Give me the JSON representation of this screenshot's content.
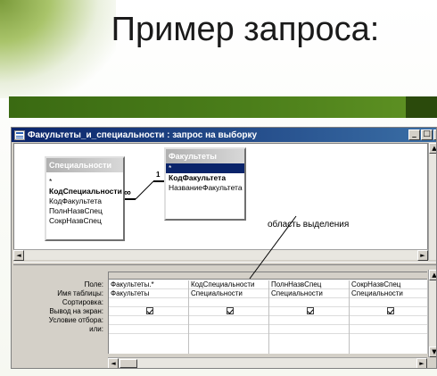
{
  "slide": {
    "title": "Пример запроса:"
  },
  "window": {
    "title": "Факультеты_и_специальности : запрос на выборку",
    "controls": [
      "_",
      "□",
      "×"
    ]
  },
  "tables": {
    "left": {
      "name": "Специальности",
      "fields": [
        "*",
        "КодСпециальности",
        "КодФакультета",
        "ПолнНазвСпец",
        "СокрНазвСпец"
      ]
    },
    "right": {
      "name": "Факультеты",
      "fields": [
        "*",
        "КодФакультета",
        "НазваниеФакультета"
      ]
    }
  },
  "relation": {
    "many": "∞",
    "one": "1"
  },
  "annotation": "область выделения",
  "grid": {
    "row_labels": [
      "Поле:",
      "Имя таблицы:",
      "Сортировка:",
      "Вывод на экран:",
      "Условие отбора:",
      "или:"
    ],
    "columns": [
      {
        "field": "Факультеты.*",
        "table": "Факультеты",
        "show": true
      },
      {
        "field": "КодСпециальности",
        "table": "Специальности",
        "show": true
      },
      {
        "field": "ПолнНазвСпец",
        "table": "Специальности",
        "show": true
      },
      {
        "field": "СокрНазвСпец",
        "table": "Специальности",
        "show": true
      }
    ]
  },
  "scroll": {
    "left_arrow": "◄",
    "right_arrow": "►",
    "up_arrow": "▲",
    "down_arrow": "▼"
  },
  "colors": {
    "green_bar": "#4b7e1a",
    "titlebar": "#0a246a"
  }
}
